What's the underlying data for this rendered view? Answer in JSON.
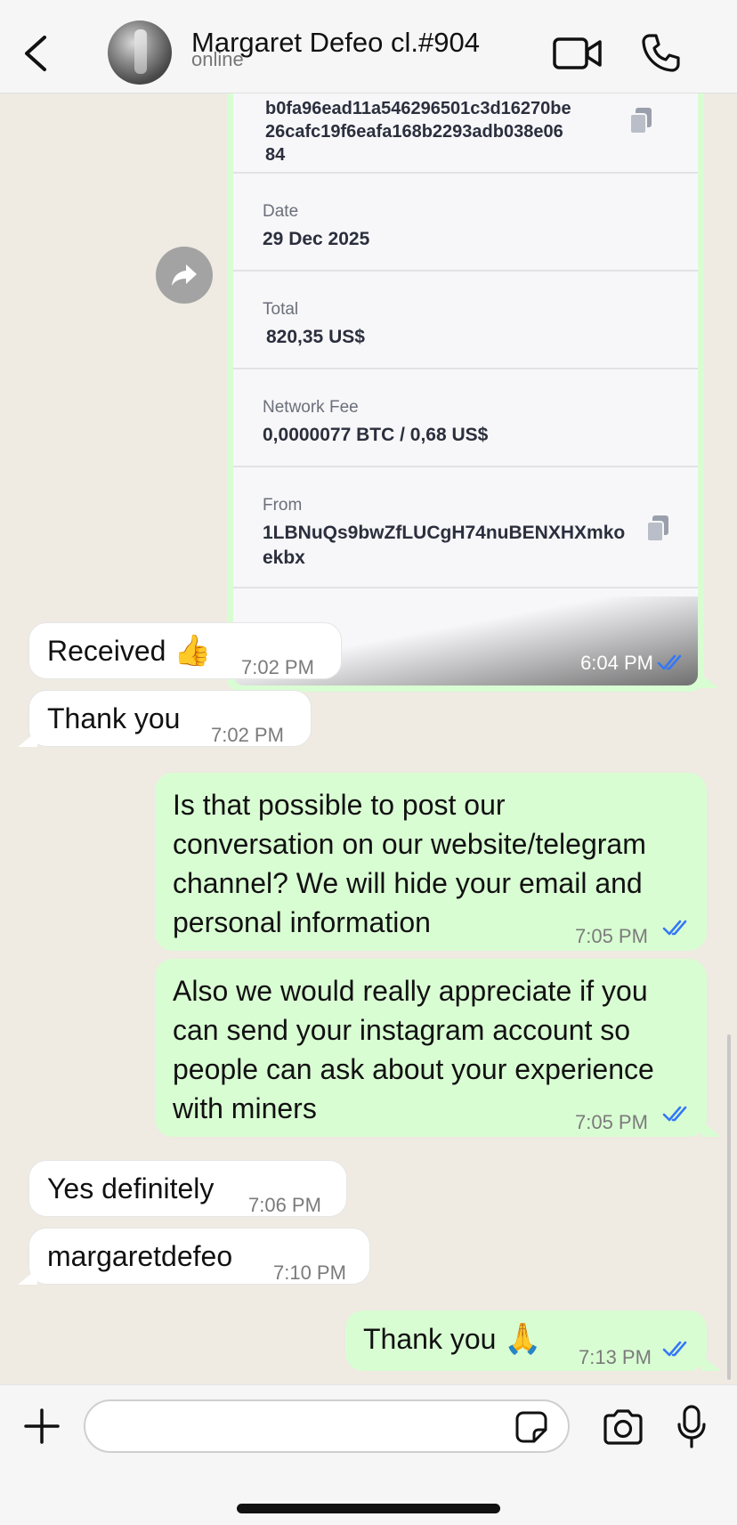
{
  "header": {
    "contact_name": "Margaret Defeo cl.#904",
    "status": "online",
    "icons": {
      "back": "chevron-left-icon",
      "video": "video-camera-icon",
      "call": "phone-icon"
    }
  },
  "receipt": {
    "hash_lines": [
      "b0fa96ead11a546296501c3d16270be",
      "26cafc19f6eafa168b2293adb038e06",
      "84"
    ],
    "date_label": "Date",
    "date_value": "29 Dec 2025",
    "total_label": "Total",
    "total_value": "820,35 US$",
    "fee_label": "Network Fee",
    "fee_value": "0,0000077 BTC / 0,68 US$",
    "from_label": "From",
    "from_lines": [
      "1LBNuQs9bwZfLUCgH74nuBENXHXmko",
      "ekbx"
    ],
    "time": "6:04 PM"
  },
  "messages": [
    {
      "dir": "in",
      "text": "Received",
      "emoji": "👍",
      "time": "7:02 PM"
    },
    {
      "dir": "in",
      "text": "Thank you",
      "time": "7:02 PM"
    },
    {
      "dir": "out",
      "lines": [
        "Is that possible to post our",
        "conversation on our website/telegram",
        "channel? We will hide your email and",
        "personal information"
      ],
      "time": "7:05 PM"
    },
    {
      "dir": "out",
      "lines": [
        "Also we would really appreciate if you",
        "can send your instagram account so",
        "people can ask about your experience",
        "with miners"
      ],
      "time": "7:05 PM"
    },
    {
      "dir": "in",
      "text": "Yes definitely",
      "time": "7:06 PM"
    },
    {
      "dir": "in",
      "text": "margaretdefeo",
      "time": "7:10 PM"
    },
    {
      "dir": "out",
      "text": "Thank you",
      "emoji": "🙏",
      "time": "7:13 PM"
    }
  ],
  "composer": {
    "input_value": "",
    "input_placeholder": "",
    "icons": {
      "add": "plus-icon",
      "sticker": "sticker-icon",
      "camera": "camera-icon",
      "mic": "microphone-icon"
    }
  },
  "colors": {
    "outgoing_bubble": "#d9fdd3",
    "incoming_bubble": "#ffffff",
    "read_ticks": "#3478f6",
    "background": "#efeae2"
  }
}
